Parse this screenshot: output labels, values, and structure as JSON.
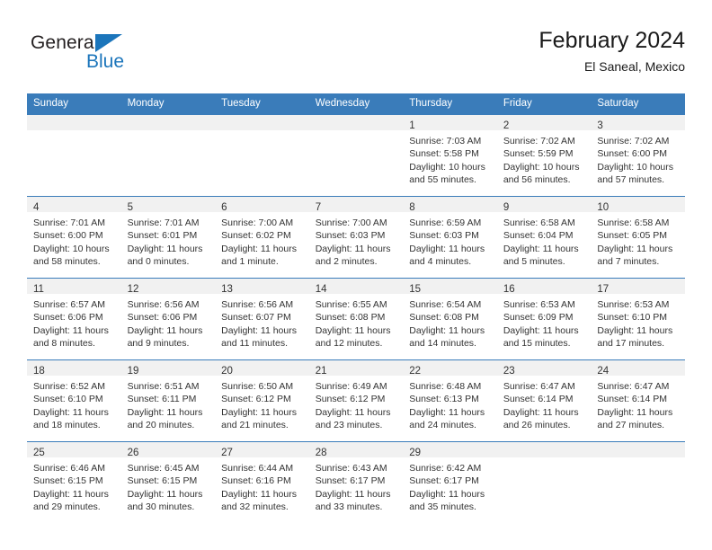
{
  "brand": {
    "word_one": "General",
    "word_two": "Blue",
    "triangle_color": "#1b75bb",
    "text_color": "#231f20"
  },
  "header": {
    "title": "February 2024",
    "subtitle": "El Saneal, Mexico"
  },
  "theme": {
    "header_bg": "#3a7cba",
    "header_text": "#ffffff",
    "daynum_band_bg": "#f1f1f1",
    "row_divider": "#3a7cba",
    "cell_text": "#333333"
  },
  "weekdays": [
    "Sunday",
    "Monday",
    "Tuesday",
    "Wednesday",
    "Thursday",
    "Friday",
    "Saturday"
  ],
  "weeks": [
    [
      {
        "empty": true
      },
      {
        "empty": true
      },
      {
        "empty": true
      },
      {
        "empty": true
      },
      {
        "day": "1",
        "sunrise": "Sunrise: 7:03 AM",
        "sunset": "Sunset: 5:58 PM",
        "daylight_1": "Daylight: 10 hours",
        "daylight_2": "and 55 minutes."
      },
      {
        "day": "2",
        "sunrise": "Sunrise: 7:02 AM",
        "sunset": "Sunset: 5:59 PM",
        "daylight_1": "Daylight: 10 hours",
        "daylight_2": "and 56 minutes."
      },
      {
        "day": "3",
        "sunrise": "Sunrise: 7:02 AM",
        "sunset": "Sunset: 6:00 PM",
        "daylight_1": "Daylight: 10 hours",
        "daylight_2": "and 57 minutes."
      }
    ],
    [
      {
        "day": "4",
        "sunrise": "Sunrise: 7:01 AM",
        "sunset": "Sunset: 6:00 PM",
        "daylight_1": "Daylight: 10 hours",
        "daylight_2": "and 58 minutes."
      },
      {
        "day": "5",
        "sunrise": "Sunrise: 7:01 AM",
        "sunset": "Sunset: 6:01 PM",
        "daylight_1": "Daylight: 11 hours",
        "daylight_2": "and 0 minutes."
      },
      {
        "day": "6",
        "sunrise": "Sunrise: 7:00 AM",
        "sunset": "Sunset: 6:02 PM",
        "daylight_1": "Daylight: 11 hours",
        "daylight_2": "and 1 minute."
      },
      {
        "day": "7",
        "sunrise": "Sunrise: 7:00 AM",
        "sunset": "Sunset: 6:03 PM",
        "daylight_1": "Daylight: 11 hours",
        "daylight_2": "and 2 minutes."
      },
      {
        "day": "8",
        "sunrise": "Sunrise: 6:59 AM",
        "sunset": "Sunset: 6:03 PM",
        "daylight_1": "Daylight: 11 hours",
        "daylight_2": "and 4 minutes."
      },
      {
        "day": "9",
        "sunrise": "Sunrise: 6:58 AM",
        "sunset": "Sunset: 6:04 PM",
        "daylight_1": "Daylight: 11 hours",
        "daylight_2": "and 5 minutes."
      },
      {
        "day": "10",
        "sunrise": "Sunrise: 6:58 AM",
        "sunset": "Sunset: 6:05 PM",
        "daylight_1": "Daylight: 11 hours",
        "daylight_2": "and 7 minutes."
      }
    ],
    [
      {
        "day": "11",
        "sunrise": "Sunrise: 6:57 AM",
        "sunset": "Sunset: 6:06 PM",
        "daylight_1": "Daylight: 11 hours",
        "daylight_2": "and 8 minutes."
      },
      {
        "day": "12",
        "sunrise": "Sunrise: 6:56 AM",
        "sunset": "Sunset: 6:06 PM",
        "daylight_1": "Daylight: 11 hours",
        "daylight_2": "and 9 minutes."
      },
      {
        "day": "13",
        "sunrise": "Sunrise: 6:56 AM",
        "sunset": "Sunset: 6:07 PM",
        "daylight_1": "Daylight: 11 hours",
        "daylight_2": "and 11 minutes."
      },
      {
        "day": "14",
        "sunrise": "Sunrise: 6:55 AM",
        "sunset": "Sunset: 6:08 PM",
        "daylight_1": "Daylight: 11 hours",
        "daylight_2": "and 12 minutes."
      },
      {
        "day": "15",
        "sunrise": "Sunrise: 6:54 AM",
        "sunset": "Sunset: 6:08 PM",
        "daylight_1": "Daylight: 11 hours",
        "daylight_2": "and 14 minutes."
      },
      {
        "day": "16",
        "sunrise": "Sunrise: 6:53 AM",
        "sunset": "Sunset: 6:09 PM",
        "daylight_1": "Daylight: 11 hours",
        "daylight_2": "and 15 minutes."
      },
      {
        "day": "17",
        "sunrise": "Sunrise: 6:53 AM",
        "sunset": "Sunset: 6:10 PM",
        "daylight_1": "Daylight: 11 hours",
        "daylight_2": "and 17 minutes."
      }
    ],
    [
      {
        "day": "18",
        "sunrise": "Sunrise: 6:52 AM",
        "sunset": "Sunset: 6:10 PM",
        "daylight_1": "Daylight: 11 hours",
        "daylight_2": "and 18 minutes."
      },
      {
        "day": "19",
        "sunrise": "Sunrise: 6:51 AM",
        "sunset": "Sunset: 6:11 PM",
        "daylight_1": "Daylight: 11 hours",
        "daylight_2": "and 20 minutes."
      },
      {
        "day": "20",
        "sunrise": "Sunrise: 6:50 AM",
        "sunset": "Sunset: 6:12 PM",
        "daylight_1": "Daylight: 11 hours",
        "daylight_2": "and 21 minutes."
      },
      {
        "day": "21",
        "sunrise": "Sunrise: 6:49 AM",
        "sunset": "Sunset: 6:12 PM",
        "daylight_1": "Daylight: 11 hours",
        "daylight_2": "and 23 minutes."
      },
      {
        "day": "22",
        "sunrise": "Sunrise: 6:48 AM",
        "sunset": "Sunset: 6:13 PM",
        "daylight_1": "Daylight: 11 hours",
        "daylight_2": "and 24 minutes."
      },
      {
        "day": "23",
        "sunrise": "Sunrise: 6:47 AM",
        "sunset": "Sunset: 6:14 PM",
        "daylight_1": "Daylight: 11 hours",
        "daylight_2": "and 26 minutes."
      },
      {
        "day": "24",
        "sunrise": "Sunrise: 6:47 AM",
        "sunset": "Sunset: 6:14 PM",
        "daylight_1": "Daylight: 11 hours",
        "daylight_2": "and 27 minutes."
      }
    ],
    [
      {
        "day": "25",
        "sunrise": "Sunrise: 6:46 AM",
        "sunset": "Sunset: 6:15 PM",
        "daylight_1": "Daylight: 11 hours",
        "daylight_2": "and 29 minutes."
      },
      {
        "day": "26",
        "sunrise": "Sunrise: 6:45 AM",
        "sunset": "Sunset: 6:15 PM",
        "daylight_1": "Daylight: 11 hours",
        "daylight_2": "and 30 minutes."
      },
      {
        "day": "27",
        "sunrise": "Sunrise: 6:44 AM",
        "sunset": "Sunset: 6:16 PM",
        "daylight_1": "Daylight: 11 hours",
        "daylight_2": "and 32 minutes."
      },
      {
        "day": "28",
        "sunrise": "Sunrise: 6:43 AM",
        "sunset": "Sunset: 6:17 PM",
        "daylight_1": "Daylight: 11 hours",
        "daylight_2": "and 33 minutes."
      },
      {
        "day": "29",
        "sunrise": "Sunrise: 6:42 AM",
        "sunset": "Sunset: 6:17 PM",
        "daylight_1": "Daylight: 11 hours",
        "daylight_2": "and 35 minutes."
      },
      {
        "empty": true
      },
      {
        "empty": true
      }
    ]
  ]
}
